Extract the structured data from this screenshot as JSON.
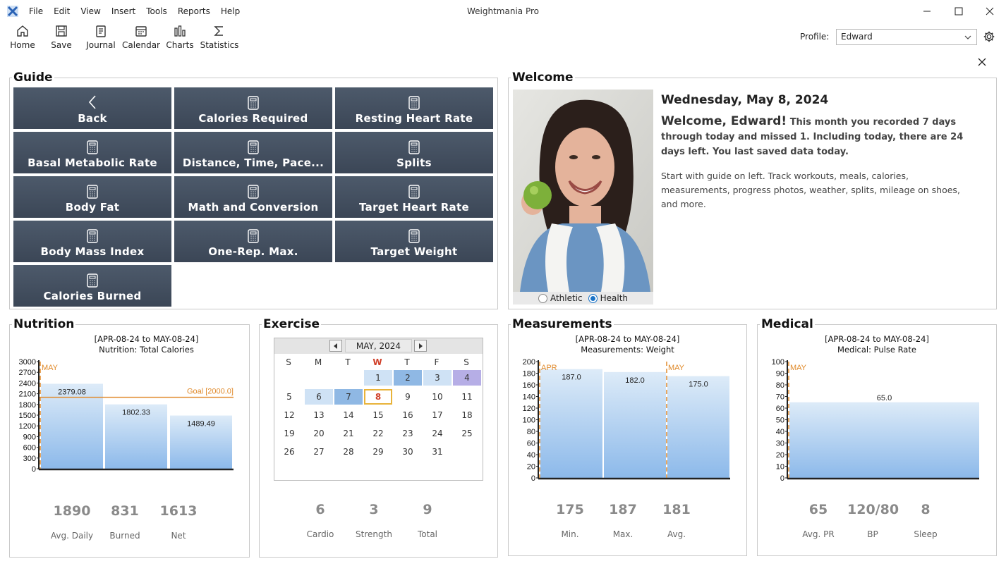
{
  "app": {
    "title": "Weightmania Pro"
  },
  "menu": [
    "File",
    "Edit",
    "View",
    "Insert",
    "Tools",
    "Reports",
    "Help"
  ],
  "toolbar": [
    {
      "label": "Home",
      "icon": "home-icon"
    },
    {
      "label": "Save",
      "icon": "save-icon"
    },
    {
      "label": "Journal",
      "icon": "journal-icon"
    },
    {
      "label": "Calendar",
      "icon": "calendar-icon"
    },
    {
      "label": "Charts",
      "icon": "charts-icon"
    },
    {
      "label": "Statistics",
      "icon": "statistics-icon"
    }
  ],
  "profile": {
    "label": "Profile:",
    "value": "Edward"
  },
  "guide": {
    "title": "Guide",
    "tiles": [
      "Back",
      "Calories Required",
      "Resting Heart Rate",
      "Basal Metabolic Rate",
      "Distance, Time, Pace...",
      "Splits",
      "Body Fat",
      "Math and Conversion",
      "Target Heart Rate",
      "Body Mass Index",
      "One-Rep. Max.",
      "Target Weight",
      "Calories Burned"
    ]
  },
  "welcome": {
    "title": "Welcome",
    "date": "Wednesday, May 8, 2024",
    "greeting": "Welcome, Edward!",
    "summary": "This month you recorded 7 days through today and missed 1. Including today, there are 24 days left. You last saved data today.",
    "hint": "Start with guide on left. Track workouts, meals, calories, measurements, progress photos, weather, splits, mileage on shoes, and more.",
    "radio": [
      {
        "label": "Athletic",
        "selected": false
      },
      {
        "label": "Health",
        "selected": true
      }
    ]
  },
  "nutrition": {
    "title": "Nutrition",
    "range": "[APR-08-24 to MAY-08-24]",
    "subtitle": "Nutrition:  Total Calories",
    "month_label": "MAY",
    "goal_label": "Goal [2000.0]",
    "stats": [
      {
        "value": "1890",
        "label": "Avg. Daily"
      },
      {
        "value": "831",
        "label": "Burned"
      },
      {
        "value": "1613",
        "label": "Net"
      }
    ]
  },
  "exercise": {
    "title": "Exercise",
    "month": "MAY, 2024",
    "weekdays": [
      "S",
      "M",
      "T",
      "W",
      "T",
      "F",
      "S"
    ],
    "days": [
      [
        "",
        "",
        "",
        "1",
        "2",
        "3",
        "4"
      ],
      [
        "5",
        "6",
        "7",
        "8",
        "9",
        "10",
        "11"
      ],
      [
        "12",
        "13",
        "14",
        "15",
        "16",
        "17",
        "18"
      ],
      [
        "19",
        "20",
        "21",
        "22",
        "23",
        "24",
        "25"
      ],
      [
        "26",
        "27",
        "28",
        "29",
        "30",
        "31",
        ""
      ]
    ],
    "highlight": {
      "1": "#cfe2f5",
      "2": "#8fb8e4",
      "3": "#cfe2f5",
      "4": "#b6aee6",
      "6": "#cfe2f5",
      "7": "#8fb8e4"
    },
    "today": "8",
    "stats": [
      {
        "value": "6",
        "label": "Cardio"
      },
      {
        "value": "3",
        "label": "Strength"
      },
      {
        "value": "9",
        "label": "Total"
      }
    ]
  },
  "measurements": {
    "title": "Measurements",
    "range": "[APR-08-24 to MAY-08-24]",
    "subtitle": "Measurements:  Weight",
    "month_labels": [
      "APR",
      "MAY"
    ],
    "stats": [
      {
        "value": "175",
        "label": "Min."
      },
      {
        "value": "187",
        "label": "Max."
      },
      {
        "value": "181",
        "label": "Avg."
      }
    ]
  },
  "medical": {
    "title": "Medical",
    "range": "[APR-08-24 to MAY-08-24]",
    "subtitle": "Medical:  Pulse Rate",
    "month_label": "MAY",
    "stats": [
      {
        "value": "65",
        "label": "Avg. PR"
      },
      {
        "value": "120/80",
        "label": "BP"
      },
      {
        "value": "8",
        "label": "Sleep"
      }
    ]
  },
  "chart_data": [
    {
      "type": "bar",
      "categories": [
        "",
        "",
        ""
      ],
      "values": [
        2379.08,
        1802.33,
        1489.49
      ],
      "value_labels": [
        "2379.08",
        "1802.33",
        "1489.49"
      ],
      "ylim": [
        0,
        3000
      ],
      "yticks": [
        0,
        300,
        600,
        900,
        1200,
        1500,
        1800,
        2100,
        2400,
        2700,
        3000
      ],
      "goal": 2000.0
    },
    {
      "type": "bar",
      "categories": [
        "",
        "",
        ""
      ],
      "values": [
        187.0,
        182.0,
        175.0
      ],
      "value_labels": [
        "187.0",
        "182.0",
        "175.0"
      ],
      "ylim": [
        0,
        200
      ],
      "yticks": [
        0,
        20,
        40,
        60,
        80,
        100,
        120,
        140,
        160,
        180,
        200
      ]
    },
    {
      "type": "bar",
      "categories": [
        ""
      ],
      "values": [
        65.0
      ],
      "value_labels": [
        "65.0"
      ],
      "ylim": [
        0,
        100
      ],
      "yticks": [
        0,
        10,
        20,
        30,
        40,
        50,
        60,
        70,
        80,
        90,
        100
      ]
    }
  ]
}
